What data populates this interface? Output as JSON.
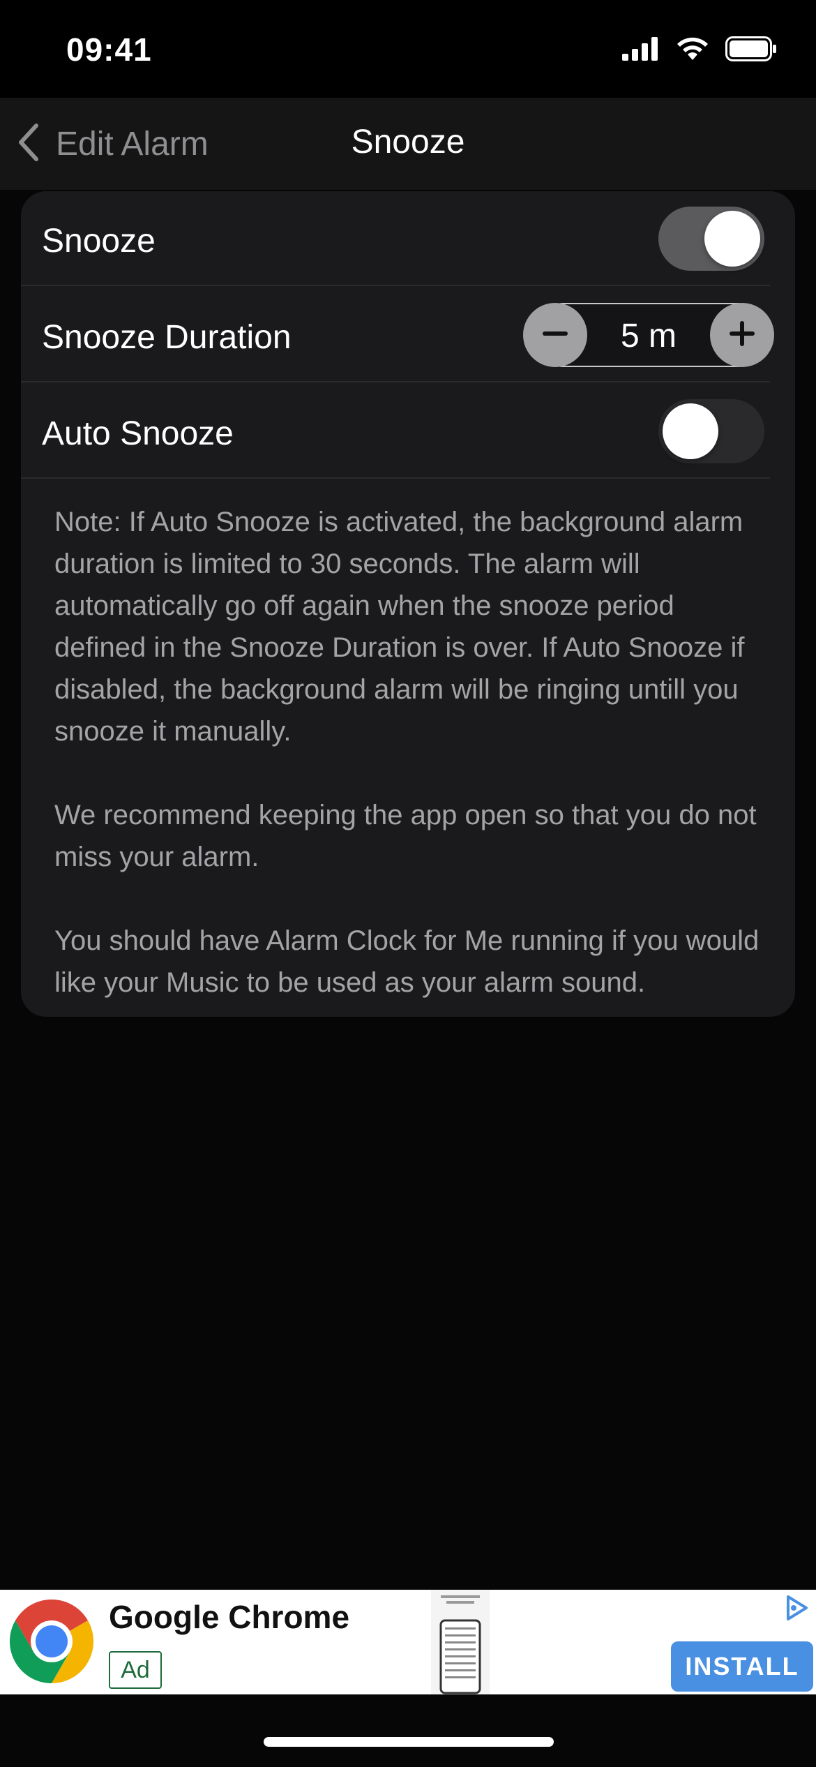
{
  "status_bar": {
    "time": "09:41",
    "icons": [
      "cellular-signal-icon",
      "wifi-icon",
      "battery-icon"
    ]
  },
  "nav": {
    "back_label": "Edit Alarm",
    "title": "Snooze"
  },
  "settings": {
    "snooze": {
      "label": "Snooze",
      "enabled": true
    },
    "snooze_duration": {
      "label": "Snooze Duration",
      "value": "5 m",
      "decrement_icon": "minus-icon",
      "increment_icon": "plus-icon"
    },
    "auto_snooze": {
      "label": "Auto Snooze",
      "enabled": false
    }
  },
  "note": {
    "paragraph_1": "Note: If Auto Snooze is activated, the background alarm duration is limited to 30 seconds. The alarm will automatically go off again when the snooze period defined in the Snooze Duration is over. If Auto Snooze if disabled, the background alarm will be ringing untill you snooze it manually.",
    "paragraph_2": "We recommend keeping the app open so that you do not miss your alarm.",
    "paragraph_3": "You should have Alarm Clock for Me running if you would like your Music to be used as your alarm sound."
  },
  "ad": {
    "title": "Google Chrome",
    "badge": "Ad",
    "button": "INSTALL",
    "logo_icon": "chrome-logo-icon",
    "choices_icon": "ad-choices-icon"
  },
  "colors": {
    "background": "#060606",
    "card": "#1a1a1c",
    "toggle_on": "#5b5b5e",
    "note_text": "#a4a4a7",
    "install_button": "#4a90e2"
  }
}
